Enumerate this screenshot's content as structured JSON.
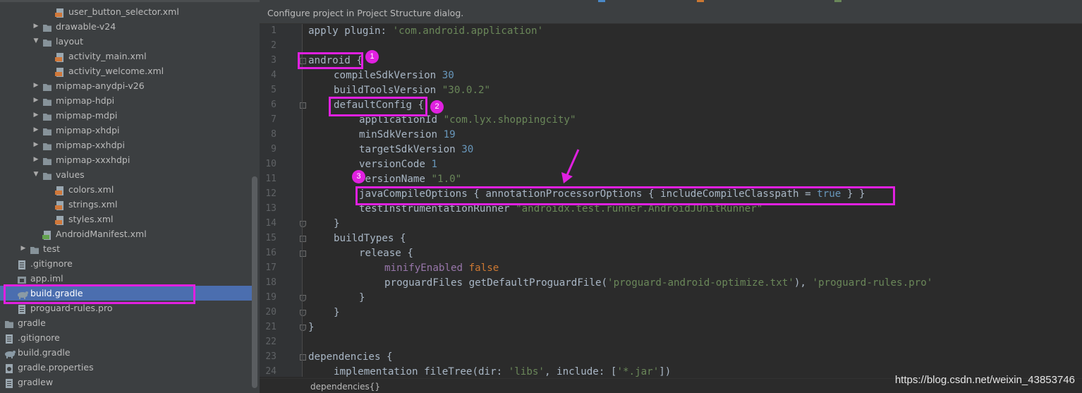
{
  "project_tree": {
    "items": [
      {
        "label": "user_button_selector.xml",
        "icon": "xml-file-icon",
        "depth": 5,
        "arrow": "none"
      },
      {
        "label": "drawable-v24",
        "icon": "folder-icon",
        "depth": 4,
        "arrow": "collapsed"
      },
      {
        "label": "layout",
        "icon": "folder-icon",
        "depth": 4,
        "arrow": "expanded"
      },
      {
        "label": "activity_main.xml",
        "icon": "xml-file-icon",
        "depth": 5,
        "arrow": "none"
      },
      {
        "label": "activity_welcome.xml",
        "icon": "xml-file-icon",
        "depth": 5,
        "arrow": "none"
      },
      {
        "label": "mipmap-anydpi-v26",
        "icon": "folder-icon",
        "depth": 4,
        "arrow": "collapsed"
      },
      {
        "label": "mipmap-hdpi",
        "icon": "folder-icon",
        "depth": 4,
        "arrow": "collapsed"
      },
      {
        "label": "mipmap-mdpi",
        "icon": "folder-icon",
        "depth": 4,
        "arrow": "collapsed"
      },
      {
        "label": "mipmap-xhdpi",
        "icon": "folder-icon",
        "depth": 4,
        "arrow": "collapsed"
      },
      {
        "label": "mipmap-xxhdpi",
        "icon": "folder-icon",
        "depth": 4,
        "arrow": "collapsed"
      },
      {
        "label": "mipmap-xxxhdpi",
        "icon": "folder-icon",
        "depth": 4,
        "arrow": "collapsed"
      },
      {
        "label": "values",
        "icon": "folder-icon",
        "depth": 4,
        "arrow": "expanded"
      },
      {
        "label": "colors.xml",
        "icon": "xml-file-icon",
        "depth": 5,
        "arrow": "none"
      },
      {
        "label": "strings.xml",
        "icon": "xml-file-icon",
        "depth": 5,
        "arrow": "none"
      },
      {
        "label": "styles.xml",
        "icon": "xml-file-icon",
        "depth": 5,
        "arrow": "none"
      },
      {
        "label": "AndroidManifest.xml",
        "icon": "manifest-file-icon",
        "depth": 4,
        "arrow": "none"
      },
      {
        "label": "test",
        "icon": "folder-icon",
        "depth": 3,
        "arrow": "collapsed"
      },
      {
        "label": ".gitignore",
        "icon": "text-file-icon",
        "depth": 2,
        "arrow": "none"
      },
      {
        "label": "app.iml",
        "icon": "module-file-icon",
        "depth": 2,
        "arrow": "none"
      },
      {
        "label": "build.gradle",
        "icon": "gradle-file-icon",
        "depth": 2,
        "arrow": "none",
        "selected": true
      },
      {
        "label": "proguard-rules.pro",
        "icon": "text-file-icon",
        "depth": 2,
        "arrow": "none"
      },
      {
        "label": "gradle",
        "icon": "folder-icon",
        "depth": 1,
        "arrow": "collapsed"
      },
      {
        "label": ".gitignore",
        "icon": "text-file-icon",
        "depth": 1,
        "arrow": "none"
      },
      {
        "label": "build.gradle",
        "icon": "gradle-file-icon",
        "depth": 1,
        "arrow": "none"
      },
      {
        "label": "gradle.properties",
        "icon": "properties-file-icon",
        "depth": 1,
        "arrow": "none"
      },
      {
        "label": "gradlew",
        "icon": "text-file-icon",
        "depth": 1,
        "arrow": "none"
      }
    ]
  },
  "editor": {
    "banner": "Configure project in Project Structure dialog.",
    "breadcrumb": "dependencies{}",
    "lines": [
      {
        "n": "1",
        "indent": 0,
        "t": [
          [
            "plain",
            "apply plugin: "
          ],
          [
            "str",
            "'com.android.application'"
          ]
        ]
      },
      {
        "n": "2",
        "indent": 0,
        "t": []
      },
      {
        "n": "3",
        "indent": 0,
        "t": [
          [
            "plain",
            "android {"
          ]
        ],
        "fold": "start"
      },
      {
        "n": "4",
        "indent": 1,
        "t": [
          [
            "plain",
            "compileSdkVersion "
          ],
          [
            "num",
            "30"
          ]
        ]
      },
      {
        "n": "5",
        "indent": 1,
        "t": [
          [
            "plain",
            "buildToolsVersion "
          ],
          [
            "str",
            "\"30.0.2\""
          ]
        ]
      },
      {
        "n": "6",
        "indent": 1,
        "t": [
          [
            "plain",
            "defaultConfig {"
          ]
        ],
        "fold": "start"
      },
      {
        "n": "7",
        "indent": 2,
        "t": [
          [
            "plain",
            "applicationId "
          ],
          [
            "str",
            "\"com.lyx.shoppingcity\""
          ]
        ]
      },
      {
        "n": "8",
        "indent": 2,
        "t": [
          [
            "plain",
            "minSdkVersion "
          ],
          [
            "num",
            "19"
          ]
        ]
      },
      {
        "n": "9",
        "indent": 2,
        "t": [
          [
            "plain",
            "targetSdkVersion "
          ],
          [
            "num",
            "30"
          ]
        ]
      },
      {
        "n": "10",
        "indent": 2,
        "t": [
          [
            "plain",
            "versionCode "
          ],
          [
            "num",
            "1"
          ]
        ]
      },
      {
        "n": "11",
        "indent": 2,
        "t": [
          [
            "plain",
            "versionName "
          ],
          [
            "str",
            "\"1.0\""
          ]
        ]
      },
      {
        "n": "12",
        "indent": 2,
        "t": [
          [
            "plain",
            "javaCompileOptions { annotationProcessorOptions { includeCompileClasspath = "
          ],
          [
            "kwb",
            "true"
          ],
          [
            "plain",
            " } }"
          ]
        ]
      },
      {
        "n": "13",
        "indent": 2,
        "t": [
          [
            "plain",
            "testInstrumentationRunner "
          ],
          [
            "str",
            "\"androidx.test.runner.AndroidJUnitRunner\""
          ]
        ]
      },
      {
        "n": "14",
        "indent": 1,
        "t": [
          [
            "plain",
            "}"
          ]
        ],
        "fold": "end"
      },
      {
        "n": "15",
        "indent": 1,
        "t": [
          [
            "plain",
            "buildTypes {"
          ]
        ],
        "fold": "start"
      },
      {
        "n": "16",
        "indent": 2,
        "t": [
          [
            "plain",
            "release {"
          ]
        ],
        "fold": "start"
      },
      {
        "n": "17",
        "indent": 3,
        "t": [
          [
            "prop",
            "minifyEnabled "
          ],
          [
            "kw",
            "false"
          ]
        ]
      },
      {
        "n": "18",
        "indent": 3,
        "t": [
          [
            "plain",
            "proguardFiles getDefaultProguardFile("
          ],
          [
            "str",
            "'proguard-android-optimize.txt'"
          ],
          [
            "plain",
            "), "
          ],
          [
            "str",
            "'proguard-rules.pro'"
          ]
        ]
      },
      {
        "n": "19",
        "indent": 2,
        "t": [
          [
            "plain",
            "}"
          ]
        ],
        "fold": "end"
      },
      {
        "n": "20",
        "indent": 1,
        "t": [
          [
            "plain",
            "}"
          ]
        ],
        "fold": "end"
      },
      {
        "n": "21",
        "indent": 0,
        "t": [
          [
            "plain",
            "}"
          ]
        ],
        "fold": "end"
      },
      {
        "n": "22",
        "indent": 0,
        "t": []
      },
      {
        "n": "23",
        "indent": 0,
        "t": [
          [
            "plain",
            "dependencies {"
          ]
        ],
        "fold": "start"
      },
      {
        "n": "24",
        "indent": 1,
        "t": [
          [
            "plain",
            "implementation fileTree(dir: "
          ],
          [
            "str",
            "'libs'"
          ],
          [
            "plain",
            ", include: ["
          ],
          [
            "str",
            "'*.jar'"
          ],
          [
            "plain",
            "])"
          ]
        ]
      }
    ]
  },
  "annotations": {
    "badges": [
      "1",
      "2",
      "3"
    ]
  },
  "watermark": "https://blog.csdn.net/weixin_43853746",
  "colors": {
    "highlight": "#e020e0",
    "selection": "#4b6eaf",
    "string": "#6a8759",
    "number": "#6897bb",
    "keyword": "#cc7832"
  }
}
